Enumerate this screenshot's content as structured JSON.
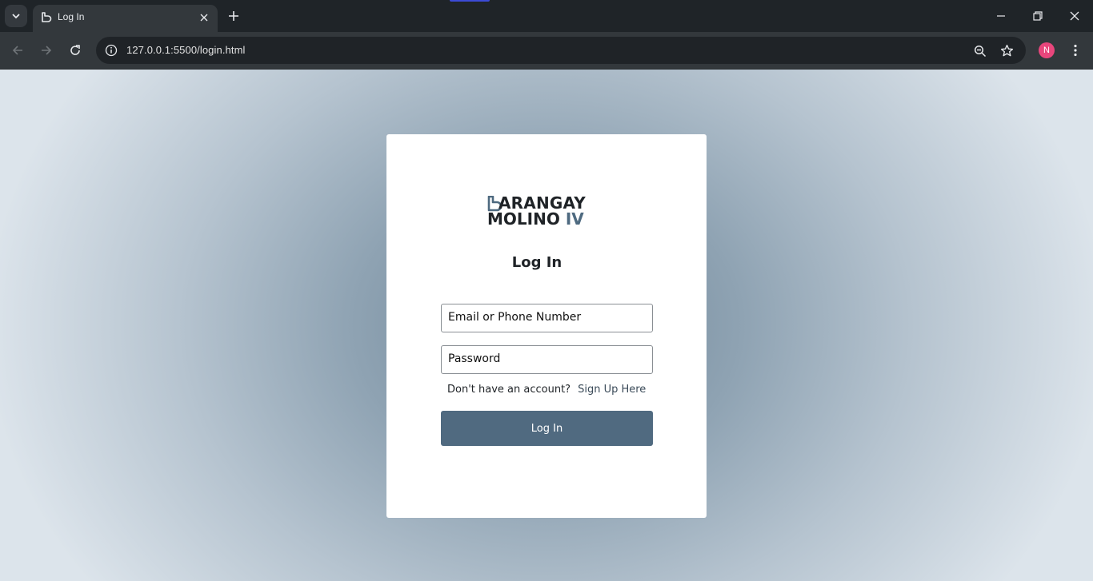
{
  "browser": {
    "tab": {
      "title": "Log In",
      "favicon": "heart-outline-icon"
    },
    "url": "127.0.0.1:5500/login.html",
    "profile_initial": "N",
    "colors": {
      "frame": "#1f2428",
      "toolbar": "#33383c",
      "omnibox": "#1f2327",
      "avatar": "#e8467c"
    }
  },
  "page": {
    "logo": {
      "line1": "ARANGAY",
      "line2": "MOLINO",
      "roman": "IV"
    },
    "heading": "Log In",
    "email_placeholder": "Email or Phone Number",
    "password_placeholder": "Password",
    "signup_prompt": "Don't have an account?",
    "signup_link": "Sign Up Here",
    "login_button": "Log In",
    "colors": {
      "accent": "#506a80",
      "card": "#ffffff"
    }
  }
}
